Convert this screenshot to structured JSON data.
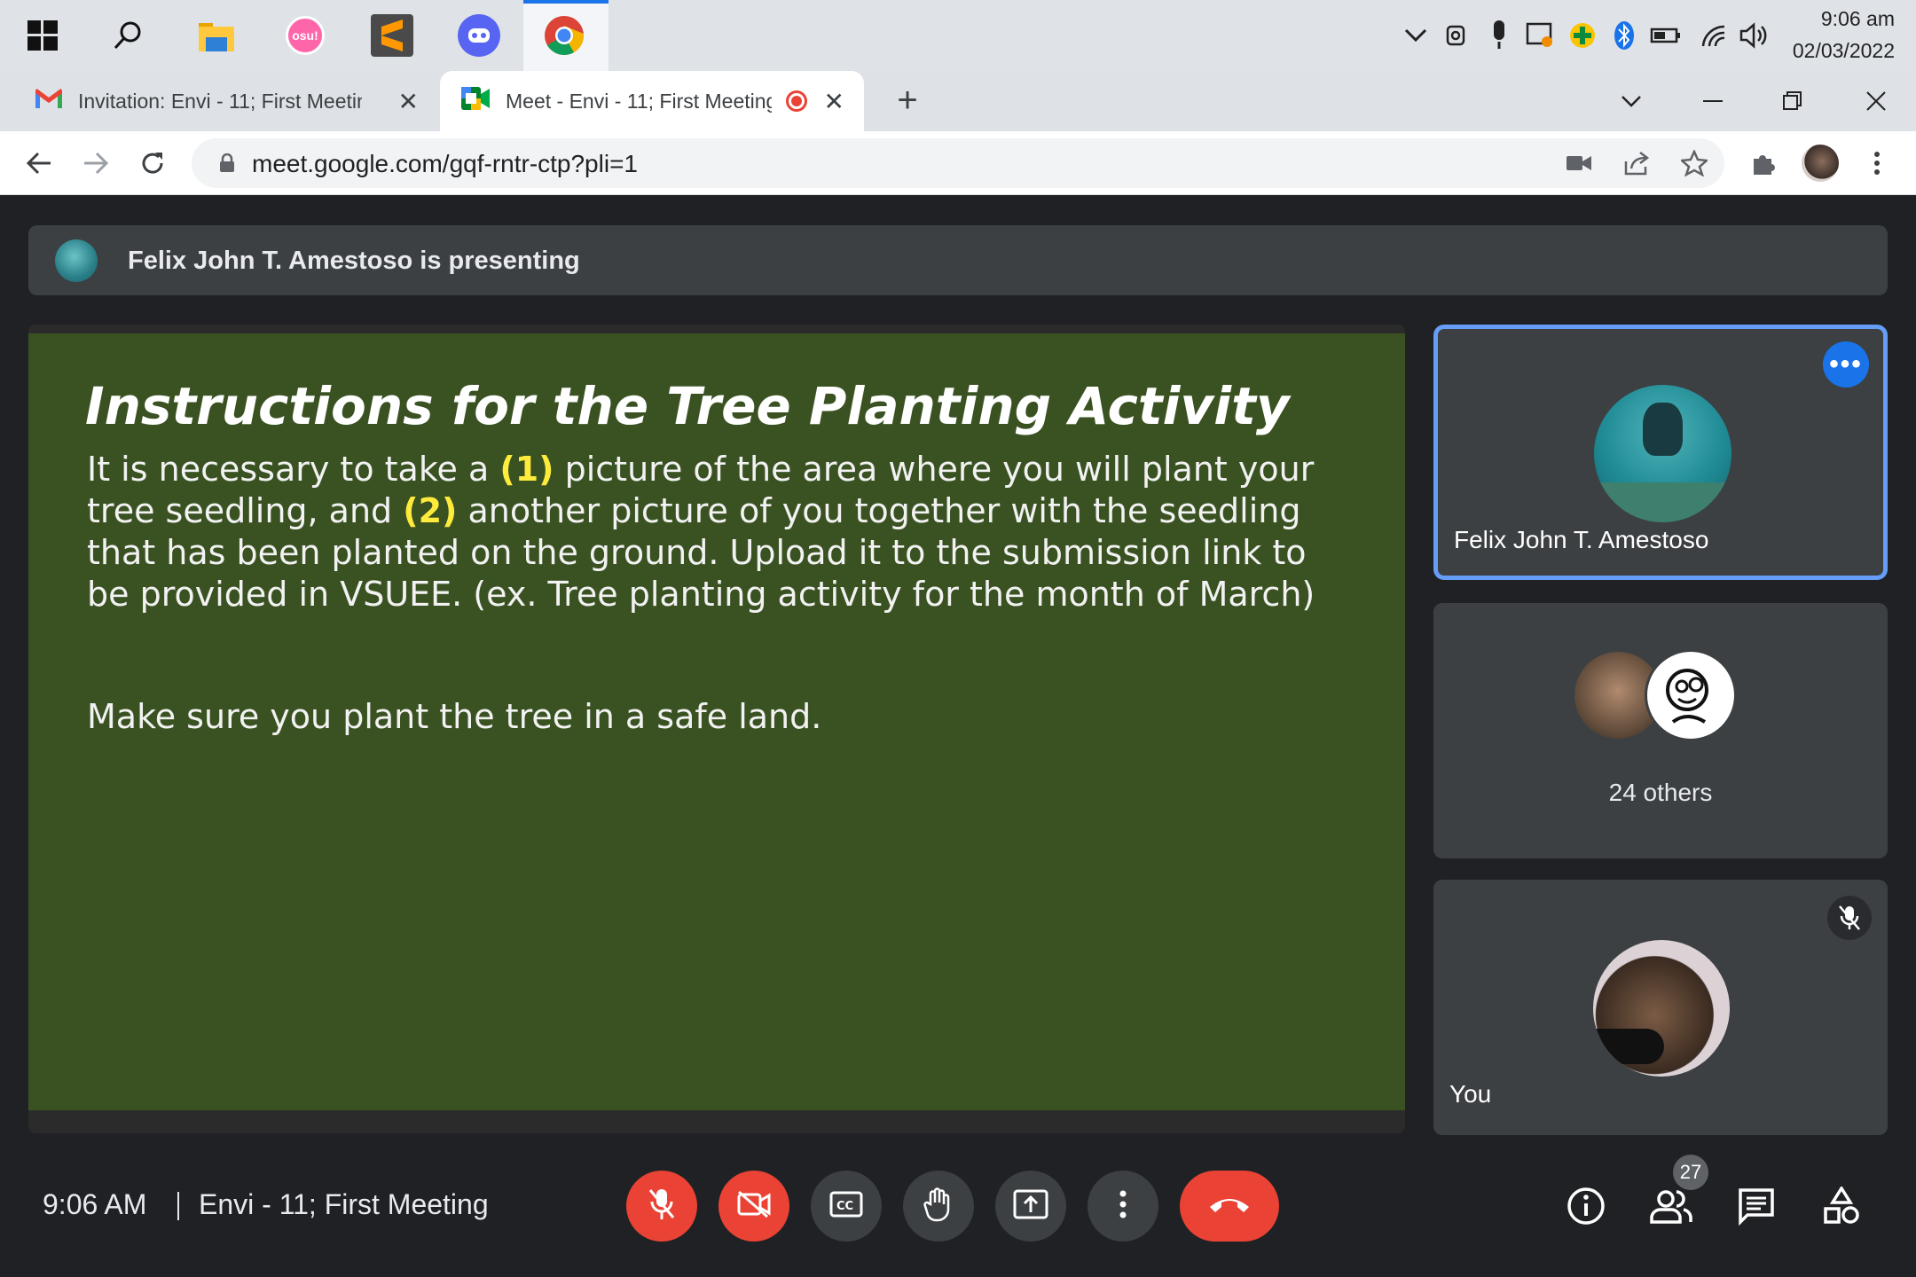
{
  "taskbar": {
    "apps": [
      {
        "name": "start",
        "icon": "windows-logo-icon"
      },
      {
        "name": "search",
        "icon": "search-icon"
      },
      {
        "name": "file-explorer",
        "icon": "folder-icon"
      },
      {
        "name": "osu",
        "icon": "osu-icon",
        "label": "osu!"
      },
      {
        "name": "sublime-text",
        "icon": "sublime-text-icon"
      },
      {
        "name": "discord",
        "icon": "discord-icon"
      },
      {
        "name": "chrome",
        "icon": "chrome-icon",
        "active": true
      }
    ],
    "clock": {
      "time": "9:06 am",
      "date": "02/03/2022"
    }
  },
  "browser": {
    "tabs": [
      {
        "title": "Invitation: Envi - 11; First Meeting",
        "favicon": "gmail-icon",
        "active": false
      },
      {
        "title": "Meet - Envi - 11; First Meeting",
        "favicon": "meet-icon",
        "active": true,
        "recording": true
      }
    ],
    "url": "meet.google.com/gqf-rntr-ctp?pli=1"
  },
  "meet": {
    "presenting_banner": "Felix John T. Amestoso is presenting",
    "slide": {
      "title": "Instructions for the Tree Planting Activity",
      "body_part1": "It is necessary to take a ",
      "hl1": "(1)",
      "body_part2": " picture of the area where you will plant your tree seedling, and ",
      "hl2": "(2)",
      "body_part3": " another picture of you together with the seedling that has been planted on the ground.  Upload it to the submission link to be provided in VSUEE. (ex. Tree planting activity for the month of March)",
      "body2": "Make sure you plant the tree in a safe land."
    },
    "tiles": {
      "presenter_name": "Felix John T. Amestoso",
      "others_label": "24 others",
      "you_label": "You"
    },
    "bottom": {
      "time": "9:06 AM",
      "meeting_title": "Envi - 11; First Meeting",
      "people_count": "27"
    },
    "colors": {
      "accent": "#1a73e8",
      "danger": "#ea4335",
      "slide_bg": "#3a5222",
      "highlight": "#ffeb3b"
    }
  }
}
